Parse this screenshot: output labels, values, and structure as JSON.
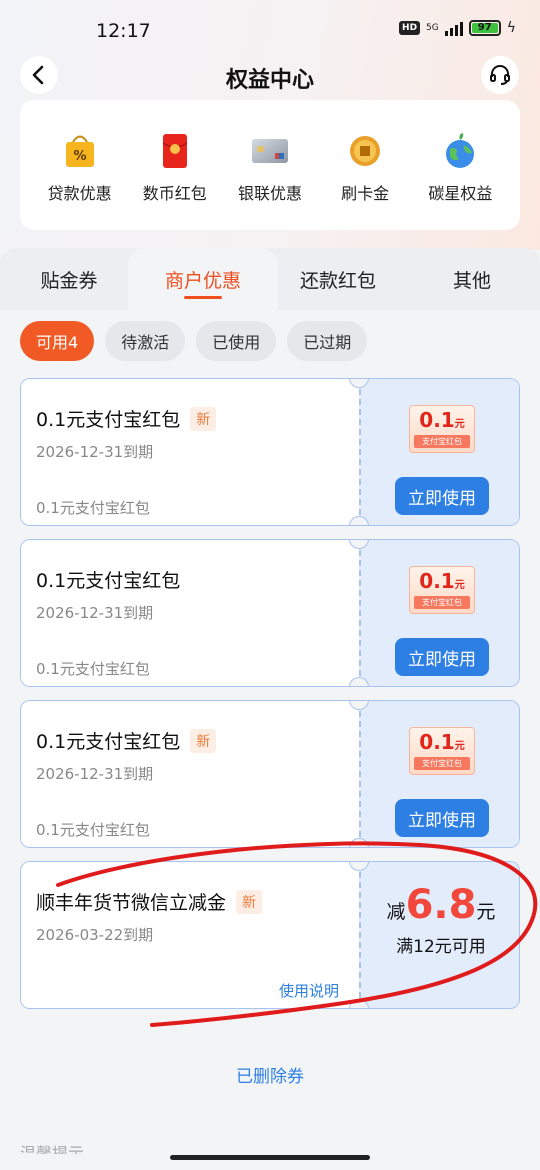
{
  "status_bar": {
    "time": "12:17",
    "hd": "HD",
    "network": "5G",
    "battery": "97"
  },
  "header": {
    "title": "权益中心",
    "back_icon": "back-arrow-icon",
    "service_icon": "headset-icon"
  },
  "benefits": [
    {
      "label": "贷款优惠",
      "icon": "loan-bag-icon"
    },
    {
      "label": "数币红包",
      "icon": "red-envelope-icon"
    },
    {
      "label": "银联优惠",
      "icon": "bank-card-icon"
    },
    {
      "label": "刷卡金",
      "icon": "gold-coin-icon"
    },
    {
      "label": "碳星权益",
      "icon": "earth-icon"
    }
  ],
  "tabs": [
    {
      "label": "贴金券"
    },
    {
      "label": "商户优惠"
    },
    {
      "label": "还款红包"
    },
    {
      "label": "其他"
    }
  ],
  "active_tab": "商户优惠",
  "filters": [
    {
      "label": "可用4"
    },
    {
      "label": "待激活"
    },
    {
      "label": "已使用"
    },
    {
      "label": "已过期"
    }
  ],
  "coupons": [
    {
      "title": "0.1元支付宝红包",
      "badge": "新",
      "expiry": "2026-12-31到期",
      "desc": "0.1元支付宝红包",
      "ticket_amount": "0.1",
      "ticket_unit": "元",
      "ticket_sub": "支付宝红包",
      "button": "立即使用"
    },
    {
      "title": "0.1元支付宝红包",
      "expiry": "2026-12-31到期",
      "desc": "0.1元支付宝红包",
      "ticket_amount": "0.1",
      "ticket_unit": "元",
      "ticket_sub": "支付宝红包",
      "button": "立即使用"
    },
    {
      "title": "0.1元支付宝红包",
      "badge": "新",
      "expiry": "2026-12-31到期",
      "desc": "0.1元支付宝红包",
      "ticket_amount": "0.1",
      "ticket_unit": "元",
      "ticket_sub": "支付宝红包",
      "button": "立即使用"
    },
    {
      "title": "顺丰年货节微信立减金",
      "badge": "新",
      "expiry": "2026-03-22到期",
      "link": "使用说明",
      "reduce_prefix": "减",
      "reduce_amount": "6.8",
      "reduce_unit": "元",
      "condition": "满12元可用"
    }
  ],
  "deleted_link": "已删除券",
  "bottom_cut_text": "温馨提示",
  "colors": {
    "accent": "#ef4f1f",
    "primary_blue": "#2d7fe4",
    "coupon_border": "#a9c3ef",
    "annotation_red": "#e01b1b"
  }
}
